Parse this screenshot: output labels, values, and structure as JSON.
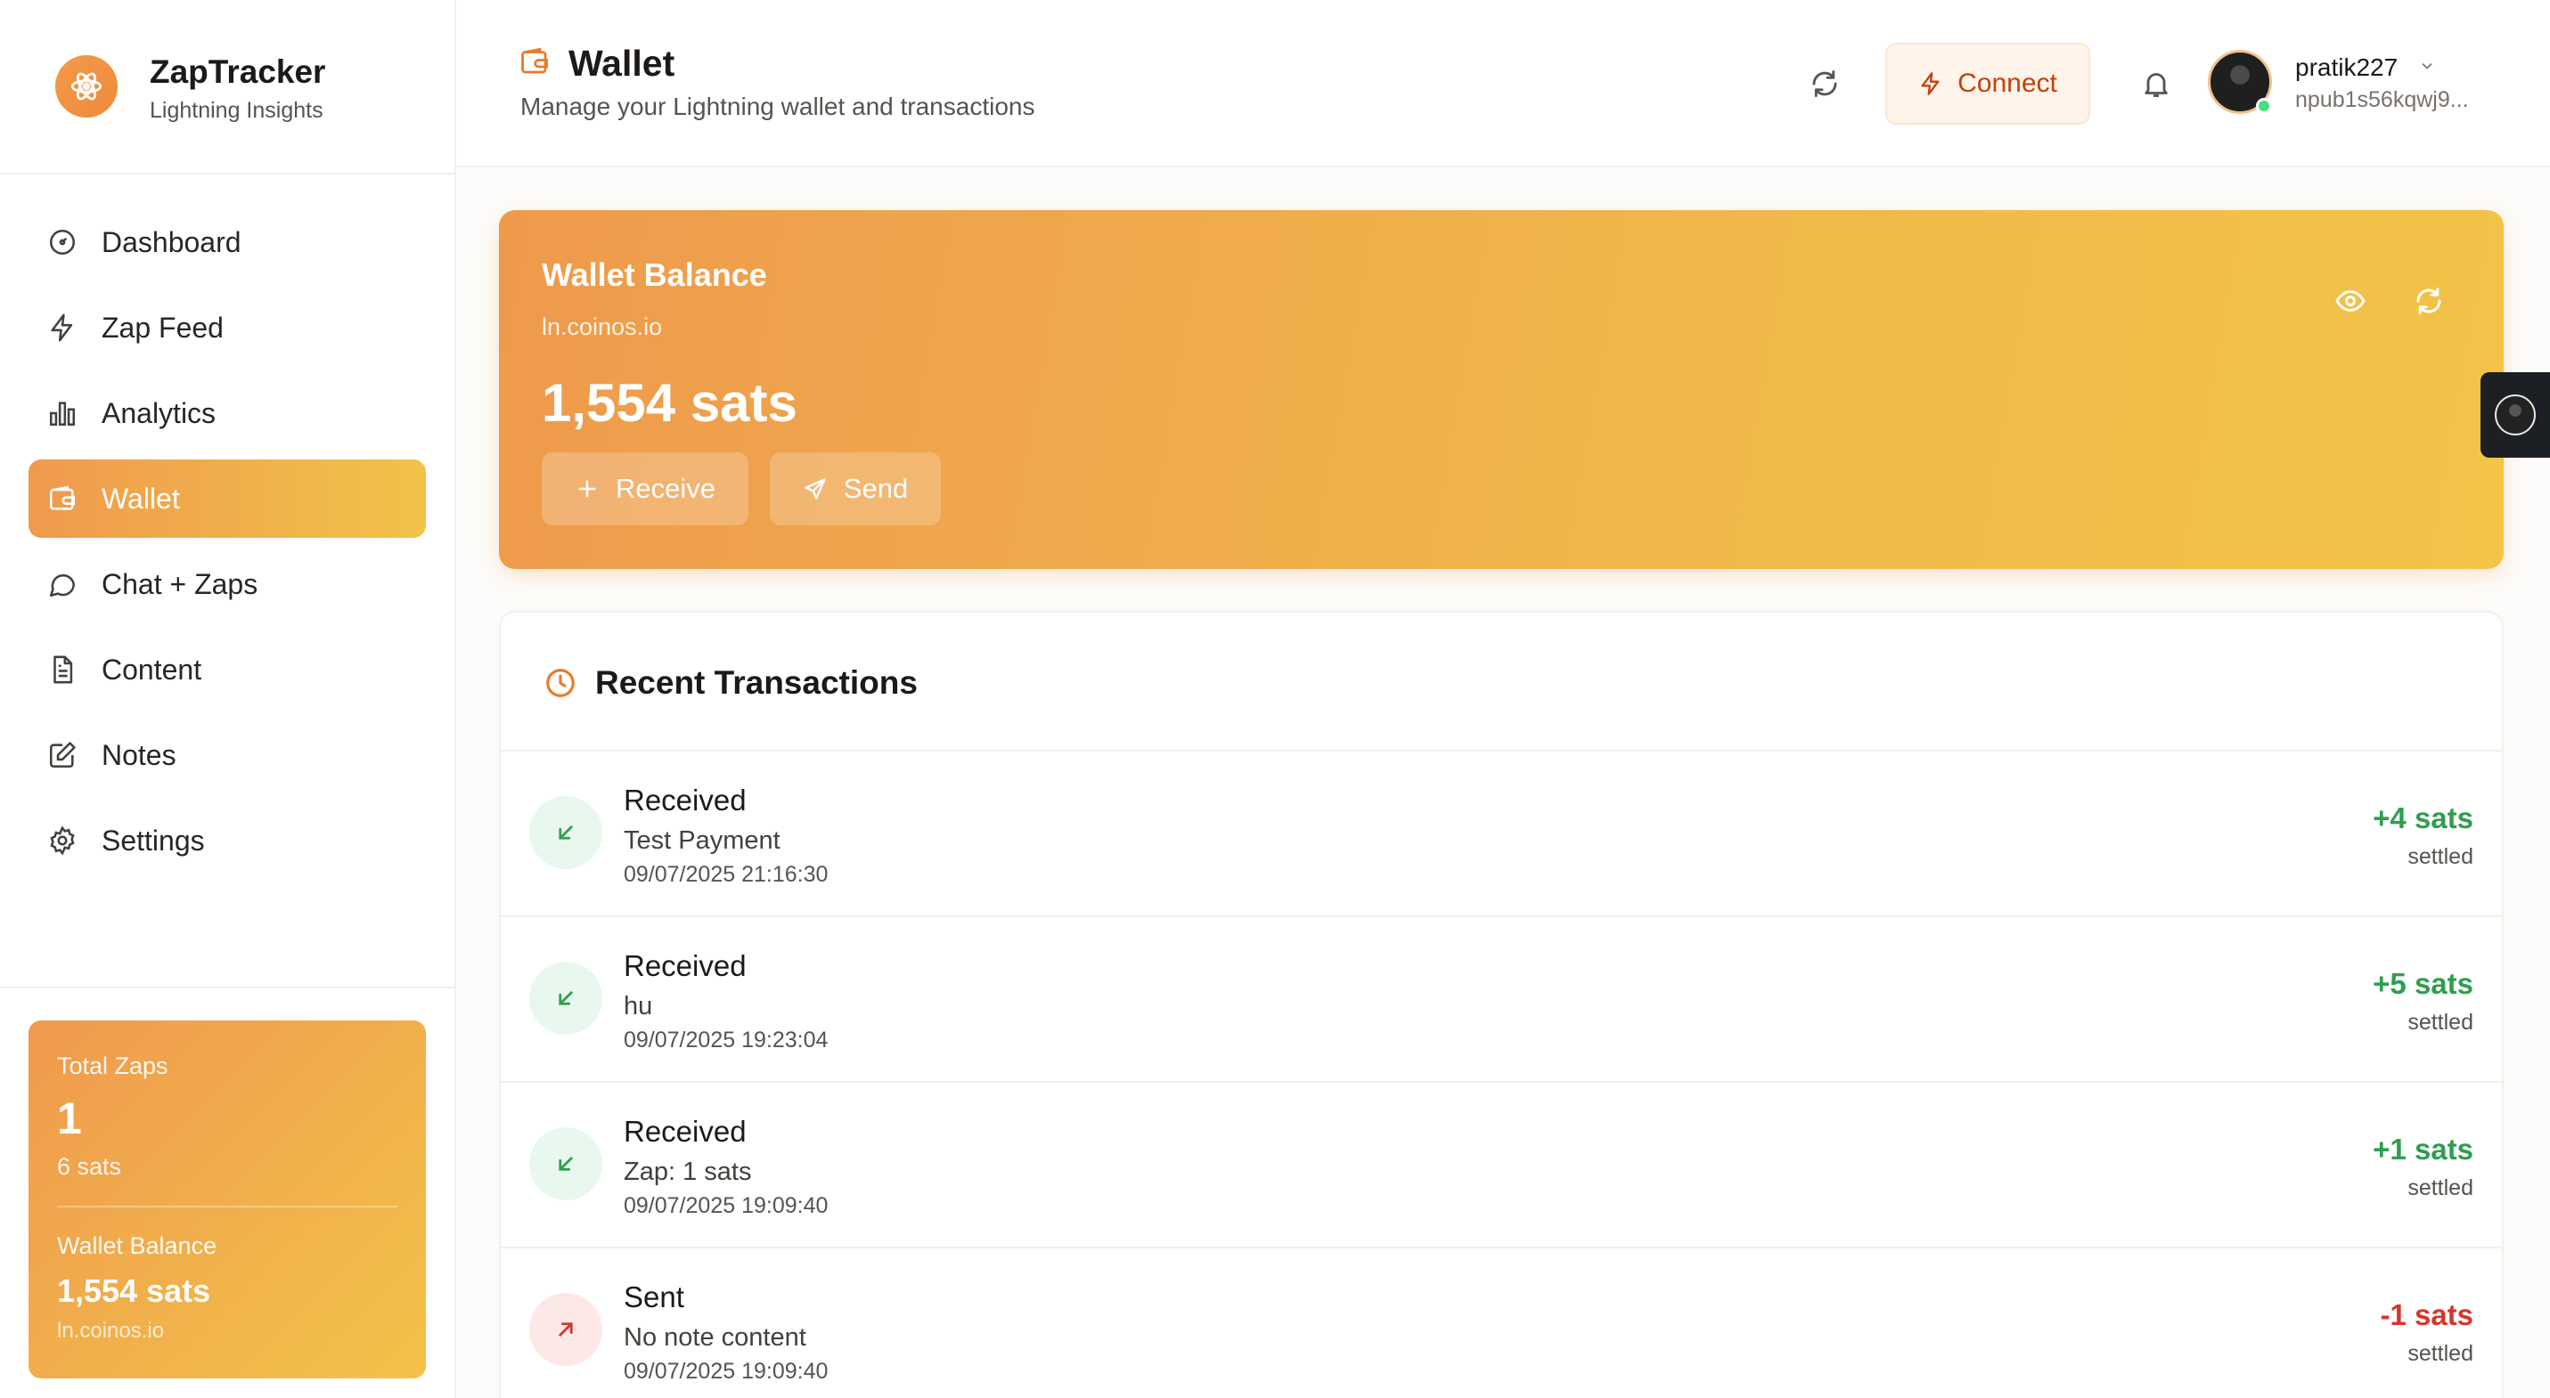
{
  "brand": {
    "title": "ZapTracker",
    "subtitle": "Lightning Insights"
  },
  "nav": [
    {
      "label": "Dashboard",
      "icon": "dashboard-icon"
    },
    {
      "label": "Zap Feed",
      "icon": "bolt-icon"
    },
    {
      "label": "Analytics",
      "icon": "bar-chart-icon"
    },
    {
      "label": "Wallet",
      "icon": "wallet-icon",
      "active": true
    },
    {
      "label": "Chat + Zaps",
      "icon": "chat-icon"
    },
    {
      "label": "Content",
      "icon": "document-icon"
    },
    {
      "label": "Notes",
      "icon": "edit-icon"
    },
    {
      "label": "Settings",
      "icon": "gear-icon"
    }
  ],
  "stats": {
    "total_zaps_label": "Total Zaps",
    "total_zaps_value": "1",
    "total_zaps_sats": "6 sats",
    "wallet_balance_label": "Wallet Balance",
    "wallet_balance_value": "1,554 sats",
    "wallet_host": "ln.coinos.io"
  },
  "header": {
    "title": "Wallet",
    "subtitle": "Manage your Lightning wallet and transactions",
    "connect_label": "Connect",
    "user_name": "pratik227",
    "user_npub": "npub1s56kqwj9..."
  },
  "balance": {
    "title": "Wallet Balance",
    "host": "ln.coinos.io",
    "amount": "1,554 sats",
    "receive_label": "Receive",
    "send_label": "Send"
  },
  "transactions": {
    "title": "Recent Transactions",
    "items": [
      {
        "type": "Received",
        "direction": "in",
        "description": "Test Payment",
        "time": "09/07/2025 21:16:30",
        "amount": "+4 sats",
        "status": "settled"
      },
      {
        "type": "Received",
        "direction": "in",
        "description": "hu",
        "time": "09/07/2025 19:23:04",
        "amount": "+5 sats",
        "status": "settled"
      },
      {
        "type": "Received",
        "direction": "in",
        "description": "Zap: 1 sats",
        "time": "09/07/2025 19:09:40",
        "amount": "+1 sats",
        "status": "settled"
      },
      {
        "type": "Sent",
        "direction": "out",
        "description": "No note content",
        "time": "09/07/2025 19:09:40",
        "amount": "-1 sats",
        "status": "settled"
      }
    ]
  },
  "colors": {
    "accent": "#ee9a4c",
    "accent_end": "#f2c448",
    "positive": "#2f9e4f",
    "negative": "#d9342b"
  }
}
